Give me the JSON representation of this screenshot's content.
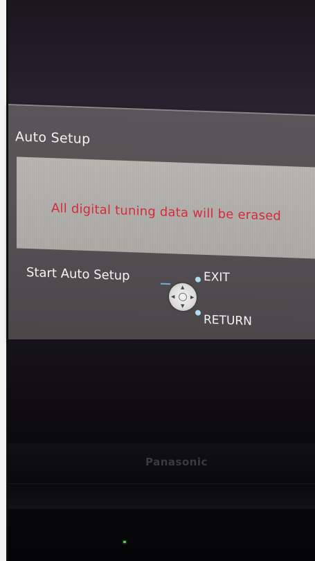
{
  "osd": {
    "title": "Auto Setup",
    "warning": "All digital tuning data will be erased",
    "start_label": "Start Auto Setup",
    "exit_label": "EXIT",
    "return_label": "RETURN"
  },
  "tv": {
    "brand": "Panasonic"
  },
  "colors": {
    "warning_text": "#d52a3a",
    "panel": "#575255",
    "led": "#5bd34a"
  },
  "icons": [
    "dpad-icon",
    "exit-dot-icon",
    "return-dot-icon"
  ]
}
